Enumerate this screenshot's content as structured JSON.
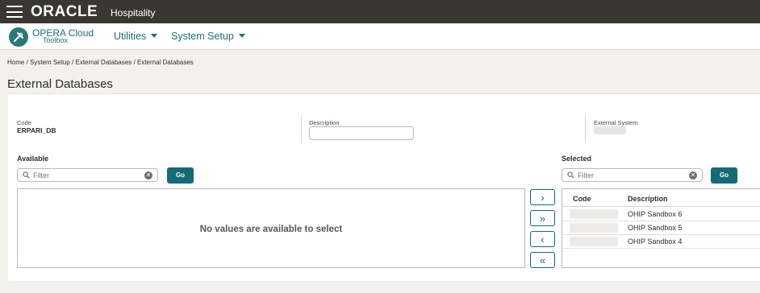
{
  "topbar": {
    "brand": "ORACLE",
    "product": "Hospitality"
  },
  "app": {
    "title": "OPERA Cloud",
    "subtitle": "Toolbox"
  },
  "nav": {
    "utilities": "Utilities",
    "system_setup": "System Setup"
  },
  "breadcrumb": "Home / System Setup / External Databases / External Databases",
  "page_title": "External Databases",
  "form": {
    "code_label": "Code",
    "code_value": "ERPARI_DB",
    "description_label": "Description",
    "description_value": "",
    "external_system_label": "External System"
  },
  "available": {
    "label": "Available",
    "filter_placeholder": "Filter",
    "go": "Go",
    "empty_message": "No values are available to select"
  },
  "selected": {
    "label": "Selected",
    "filter_placeholder": "Filter",
    "go": "Go",
    "columns": [
      "Code",
      "Description"
    ],
    "rows": [
      {
        "description": "OHIP Sandbox 6"
      },
      {
        "description": "OHIP Sandbox 5"
      },
      {
        "description": "OHIP Sandbox 4"
      }
    ]
  },
  "shuttle": {
    "move_right": "›",
    "move_all_right": "»",
    "move_left": "‹",
    "move_all_left": "«"
  },
  "colors": {
    "topbar": "#3a3631",
    "accent": "#146b78",
    "link": "#1c6c77"
  }
}
